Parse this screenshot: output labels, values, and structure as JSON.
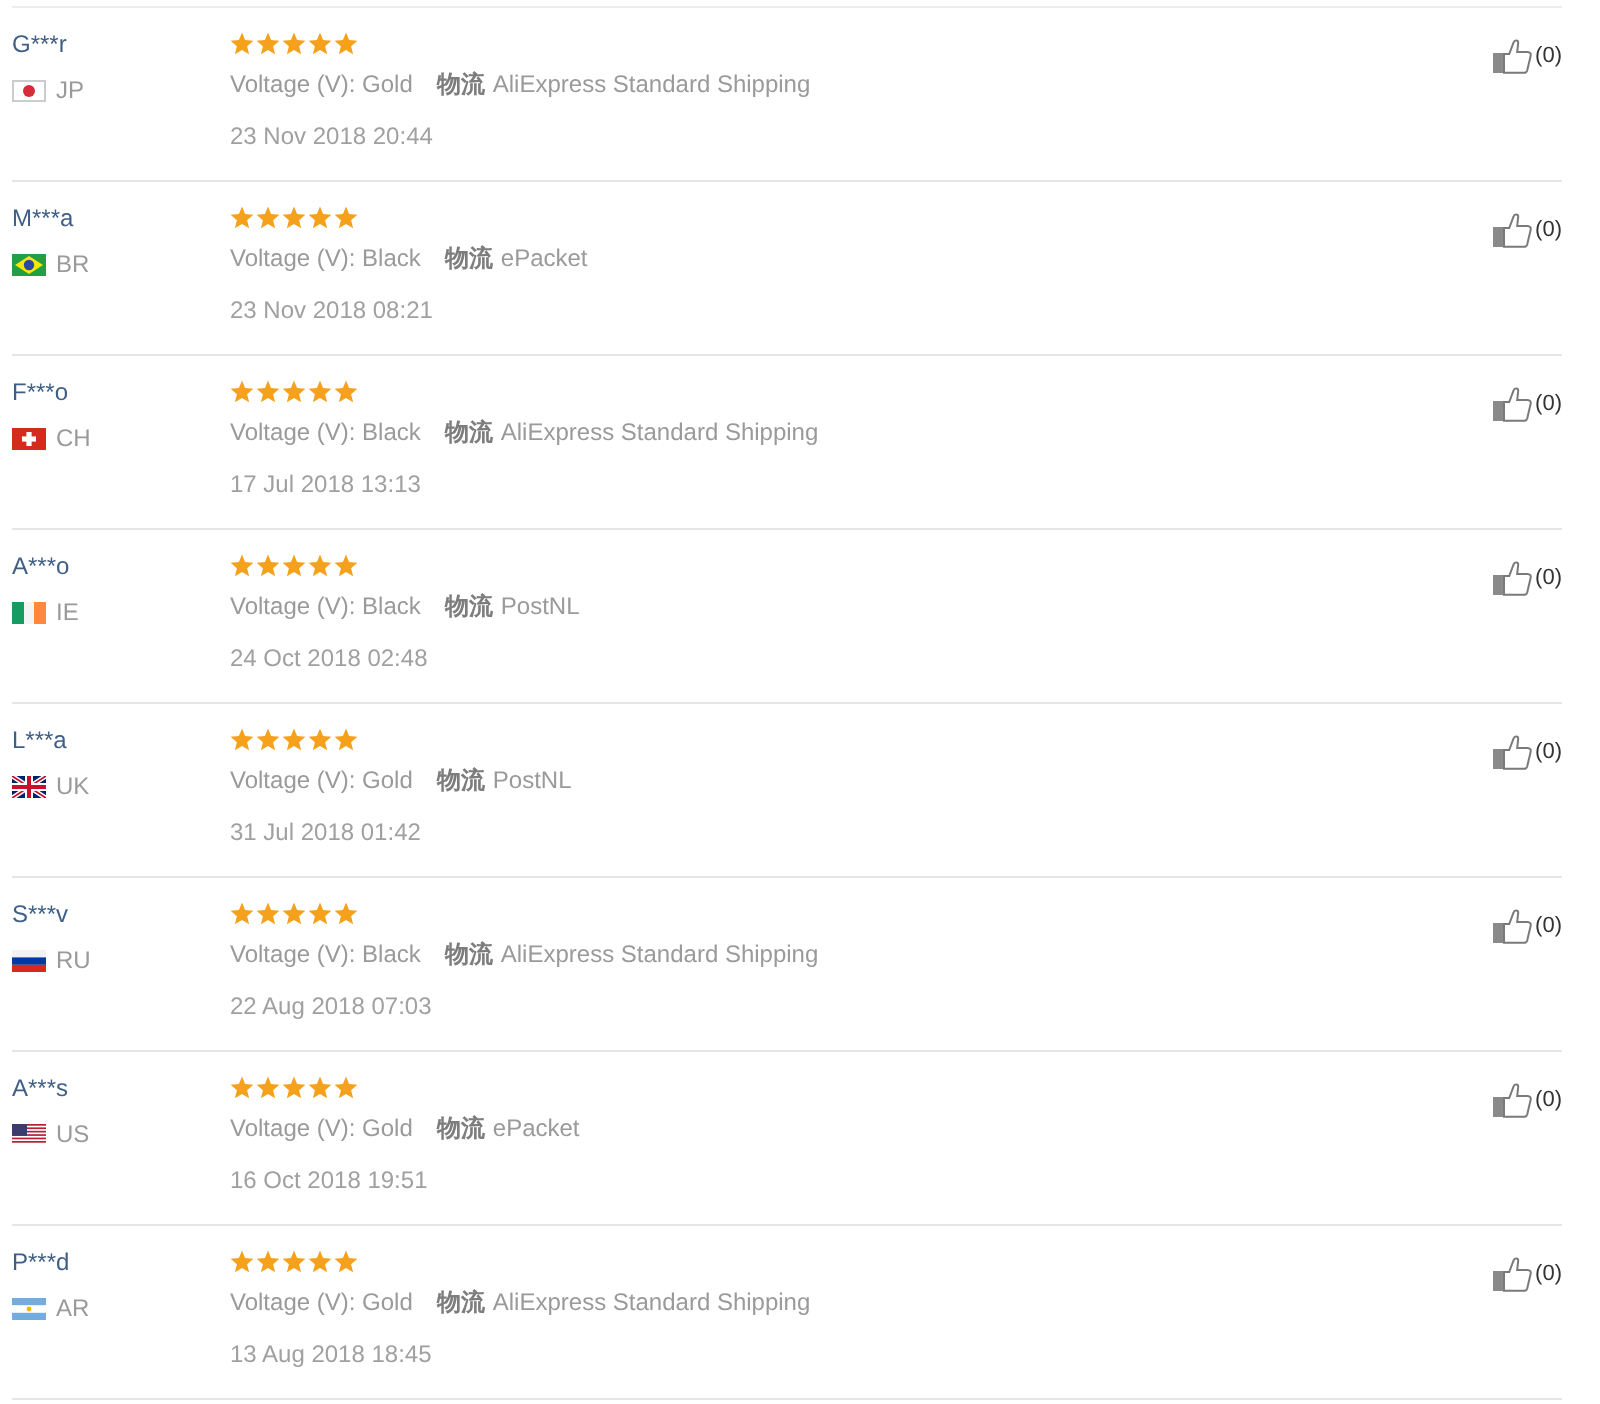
{
  "reviews": [
    {
      "name": "G***r",
      "kind": "japan",
      "country": "JP",
      "stars": 5,
      "voltage": "Voltage (V): Gold",
      "shipping_label": "物流",
      "shipping": "AliExpress Standard Shipping",
      "date": "23 Nov 2018 20:44",
      "likes": "(0)"
    },
    {
      "name": "M***a",
      "kind": "brazil",
      "country": "BR",
      "stars": 5,
      "voltage": "Voltage (V): Black",
      "shipping_label": "物流",
      "shipping": "ePacket",
      "date": "23 Nov 2018 08:21",
      "likes": "(0)"
    },
    {
      "name": "F***o",
      "kind": "swiss",
      "country": "CH",
      "stars": 5,
      "voltage": "Voltage (V): Black",
      "shipping_label": "物流",
      "shipping": "AliExpress Standard Shipping",
      "date": "17 Jul 2018 13:13",
      "likes": "(0)"
    },
    {
      "name": "A***o",
      "kind": "irish",
      "country": "IE",
      "stars": 5,
      "voltage": "Voltage (V): Black",
      "shipping_label": "物流",
      "shipping": "PostNL",
      "date": "24 Oct 2018 02:48",
      "likes": "(0)"
    },
    {
      "name": "L***a",
      "kind": "british",
      "country": "UK",
      "stars": 5,
      "voltage": "Voltage (V): Gold",
      "shipping_label": "物流",
      "shipping": "PostNL",
      "date": "31 Jul 2018 01:42",
      "likes": "(0)"
    },
    {
      "name": "S***v",
      "kind": "russian",
      "country": "RU",
      "stars": 5,
      "voltage": "Voltage (V): Black",
      "shipping_label": "物流",
      "shipping": "AliExpress Standard Shipping",
      "date": "22 Aug 2018 07:03",
      "likes": "(0)"
    },
    {
      "name": "A***s",
      "kind": "american",
      "country": "US",
      "stars": 5,
      "voltage": "Voltage (V): Gold",
      "shipping_label": "物流",
      "shipping": "ePacket",
      "date": "16 Oct 2018 19:51",
      "likes": "(0)"
    },
    {
      "name": "P***d",
      "kind": "argentine",
      "country": "AR",
      "stars": 5,
      "voltage": "Voltage (V): Gold",
      "shipping_label": "物流",
      "shipping": "AliExpress Standard Shipping",
      "date": "13 Aug 2018 18:45",
      "likes": "(0)"
    }
  ]
}
